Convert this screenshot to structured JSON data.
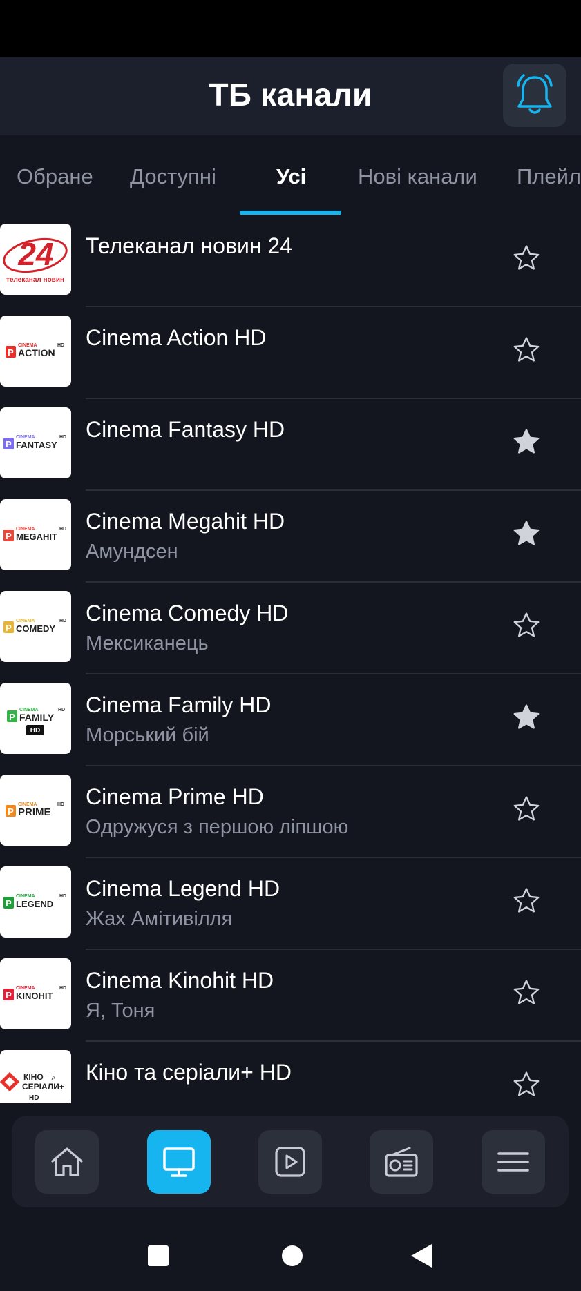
{
  "header": {
    "title": "ТБ канали",
    "bell_icon": "bell-icon",
    "accent_color": "#17b5f0"
  },
  "tabs": [
    {
      "label": "Обране",
      "active": false
    },
    {
      "label": "Доступні",
      "active": false
    },
    {
      "label": "Усі",
      "active": true
    },
    {
      "label": "Нові канали",
      "active": false
    },
    {
      "label": "Плейл",
      "active": false
    }
  ],
  "channels": [
    {
      "name": "Телеканал новин 24",
      "program": "",
      "favorite": false,
      "logo": {
        "big": "24",
        "small": "телеканал новин",
        "color": "#d3232a"
      }
    },
    {
      "name": "Cinema Action HD",
      "program": "",
      "favorite": false,
      "logo": {
        "brand": "CINEMA",
        "word": "ACTION",
        "hd": "HD",
        "color": "#e5322d"
      }
    },
    {
      "name": "Cinema Fantasy HD",
      "program": "",
      "favorite": true,
      "logo": {
        "brand": "CINEMA",
        "word": "FANTASY",
        "hd": "HD",
        "color": "#7b6cf0"
      }
    },
    {
      "name": "Cinema Megahit HD",
      "program": "Амундсен",
      "favorite": true,
      "logo": {
        "brand": "CINEMA",
        "word": "MEGAHIT",
        "hd": "HD",
        "color": "#e8473c"
      }
    },
    {
      "name": "Cinema Comedy HD",
      "program": "Мексиканець",
      "favorite": false,
      "logo": {
        "brand": "CINEMA",
        "word": "COMEDY",
        "hd": "HD",
        "color": "#e7b436"
      }
    },
    {
      "name": "Cinema Family HD",
      "program": "Морський бій",
      "favorite": true,
      "logo": {
        "brand": "CINEMA",
        "word": "FAMILY",
        "hd": "HD",
        "color": "#35b44a"
      }
    },
    {
      "name": "Cinema Prime HD",
      "program": "Одружуся з першою ліпшою",
      "favorite": false,
      "logo": {
        "brand": "CINEMA",
        "word": "PRIME",
        "hd": "HD",
        "color": "#ef8a22"
      }
    },
    {
      "name": "Cinema Legend HD",
      "program": "Жах Амітивілля",
      "favorite": false,
      "logo": {
        "brand": "CINEMA",
        "word": "LEGEND",
        "hd": "HD",
        "color": "#1f9e3a"
      }
    },
    {
      "name": "Cinema Kinohit HD",
      "program": "Я, Тоня",
      "favorite": false,
      "logo": {
        "brand": "CINEMA",
        "word": "KINOHIT",
        "hd": "HD",
        "color": "#e5213a"
      }
    },
    {
      "name": "Кіно та серіали+ HD",
      "program": "",
      "favorite": false,
      "logo": {
        "line1": "КІНО",
        "line1b": "ТА",
        "line2": "СЕРІАЛИ+",
        "line3": "HD",
        "color": "#e5322d"
      }
    }
  ],
  "bottom_nav": [
    {
      "icon": "home-icon",
      "active": false
    },
    {
      "icon": "tv-icon",
      "active": true
    },
    {
      "icon": "video-play-icon",
      "active": false
    },
    {
      "icon": "radio-icon",
      "active": false
    },
    {
      "icon": "menu-icon",
      "active": false
    }
  ],
  "system_nav": [
    "recents-square-icon",
    "home-circle-icon",
    "back-triangle-icon"
  ]
}
